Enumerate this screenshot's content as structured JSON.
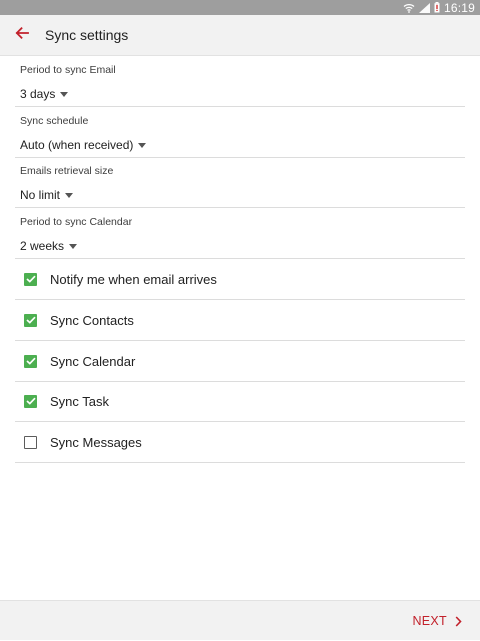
{
  "status_bar": {
    "time": "16:19",
    "icons": [
      "wifi-icon",
      "signal-icon",
      "battery-low-icon"
    ],
    "color": "#9e9e9e"
  },
  "header": {
    "title": "Sync settings",
    "back_icon": "arrow-left-icon",
    "accent_color": "#c2212b"
  },
  "settings": [
    {
      "label": "Period to sync Email",
      "value": "3 days"
    },
    {
      "label": "Sync schedule",
      "value": "Auto (when received)"
    },
    {
      "label": "Emails retrieval size",
      "value": "No limit"
    },
    {
      "label": "Period to sync Calendar",
      "value": "2 weeks"
    }
  ],
  "options": [
    {
      "label": "Notify me when email arrives",
      "checked": true
    },
    {
      "label": "Sync Contacts",
      "checked": true
    },
    {
      "label": "Sync Calendar",
      "checked": true
    },
    {
      "label": "Sync Task",
      "checked": true
    },
    {
      "label": "Sync Messages",
      "checked": false
    }
  ],
  "footer": {
    "next_label": "NEXT",
    "next_icon": "chevron-right-icon"
  },
  "colors": {
    "checkbox_checked": "#4caf50",
    "accent": "#c2212b"
  }
}
